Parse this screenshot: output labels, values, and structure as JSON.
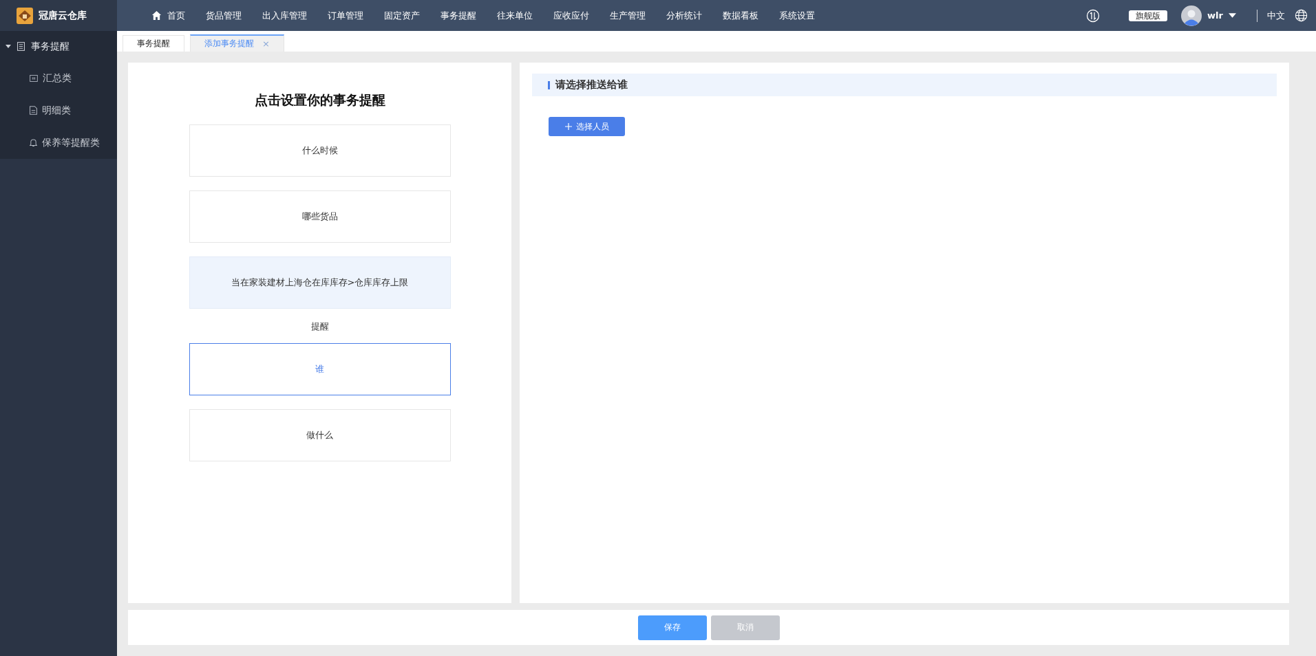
{
  "app": {
    "name": "冠唐云仓库"
  },
  "nav": [
    {
      "label": "首页"
    },
    {
      "label": "货品管理"
    },
    {
      "label": "出入库管理"
    },
    {
      "label": "订单管理"
    },
    {
      "label": "固定资产"
    },
    {
      "label": "事务提醒"
    },
    {
      "label": "往来单位"
    },
    {
      "label": "应收应付"
    },
    {
      "label": "生产管理"
    },
    {
      "label": "分析统计"
    },
    {
      "label": "数据看板"
    },
    {
      "label": "系统设置"
    }
  ],
  "header": {
    "edition": "旗舰版",
    "user": "wlr",
    "language": "中文"
  },
  "sidebar": {
    "group": {
      "label": "事务提醒",
      "expanded": true
    },
    "items": [
      {
        "label": "汇总类"
      },
      {
        "label": "明细类"
      },
      {
        "label": "保养等提醒类"
      }
    ]
  },
  "tabs": [
    {
      "label": "事务提醒",
      "selected": false
    },
    {
      "label": "添加事务提醒",
      "selected": true,
      "close": "×"
    }
  ],
  "setup": {
    "title": "点击设置你的事务提醒",
    "steps": [
      {
        "kind": "card",
        "label": "什么时候",
        "selected": false,
        "configured": false
      },
      {
        "kind": "card",
        "label": "哪些货品",
        "selected": false,
        "configured": false
      },
      {
        "kind": "card",
        "label": "当在家装建材上海仓在库库存>仓库库存上限",
        "selected": false,
        "configured": true
      },
      {
        "kind": "label",
        "label": "提醒"
      },
      {
        "kind": "card",
        "label": "谁",
        "selected": true,
        "configured": false
      },
      {
        "kind": "card",
        "label": "做什么",
        "selected": false,
        "configured": false
      }
    ]
  },
  "detail": {
    "heading": "请选择推送给谁",
    "button": "选择人员"
  },
  "footer": {
    "buttons": [
      {
        "label": "保存",
        "disabled": false
      },
      {
        "label": "取消",
        "disabled": true
      }
    ]
  }
}
